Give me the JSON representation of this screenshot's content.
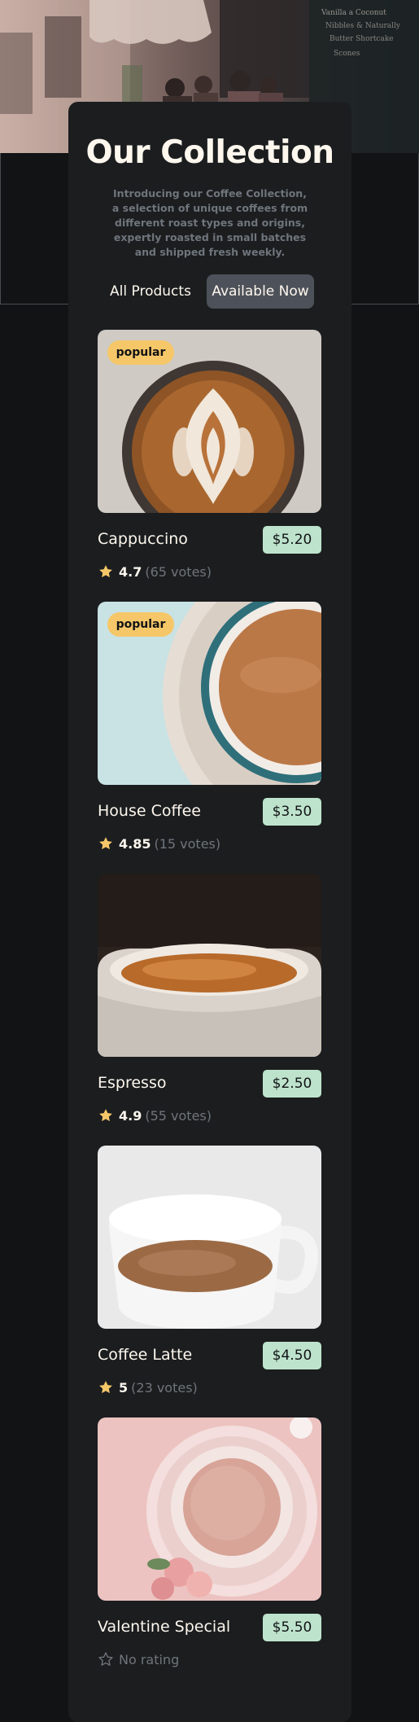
{
  "page": {
    "title": "Our Collection",
    "intro": "Introducing our Coffee Collection, a selection of unique coffees from different roast types and origins, expertly roasted in small batches and shipped fresh weekly."
  },
  "filters": {
    "all_label": "All Products",
    "available_label": "Available Now",
    "active": "Available Now"
  },
  "products": [
    {
      "name": "Cappuccino",
      "price": "$5.20",
      "badge": "popular",
      "rating": "4.7",
      "votes": "(65 votes)"
    },
    {
      "name": "House Coffee",
      "price": "$3.50",
      "badge": "popular",
      "rating": "4.85",
      "votes": "(15 votes)"
    },
    {
      "name": "Espresso",
      "price": "$2.50",
      "badge": null,
      "rating": "4.9",
      "votes": "(55 votes)"
    },
    {
      "name": "Coffee Latte",
      "price": "$4.50",
      "badge": null,
      "rating": "5",
      "votes": "(23 votes)"
    },
    {
      "name": "Valentine Special",
      "price": "$5.50",
      "badge": null,
      "rating": null,
      "votes": null,
      "no_rating_label": "No rating"
    }
  ],
  "icons": {
    "star_filled": "star-filled-icon",
    "star_empty": "star-outline-icon"
  },
  "colors": {
    "background": "#111315",
    "card": "#1b1d1f",
    "text": "#fef7ee",
    "muted": "#6f757c",
    "badge": "#f6c768",
    "price": "#bee3cc",
    "star": "#f6c768",
    "active_filter": "#4d5159"
  }
}
